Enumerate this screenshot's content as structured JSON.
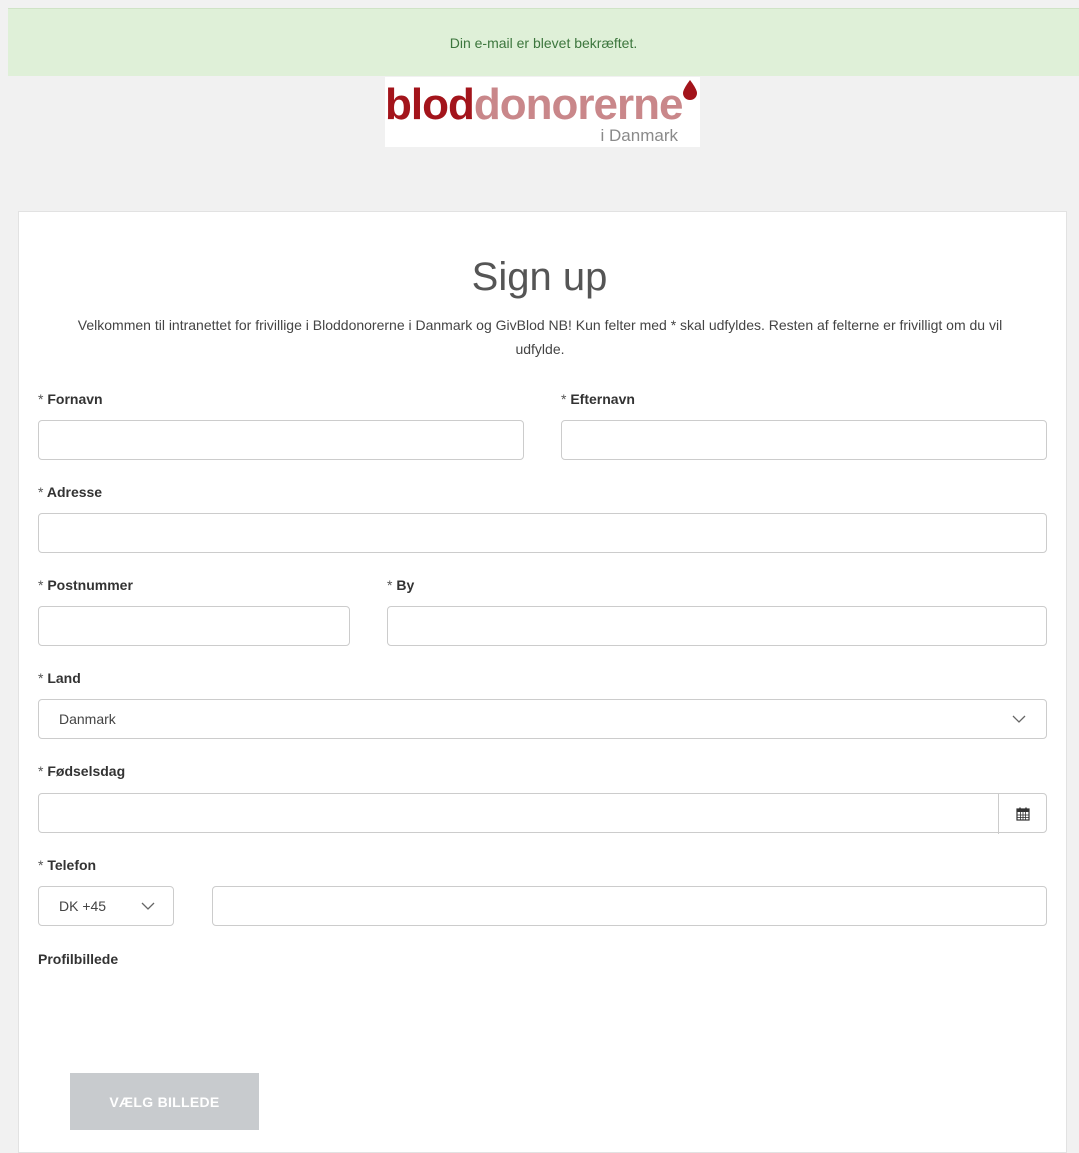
{
  "alert": {
    "message": "Din e-mail er blevet bekræftet."
  },
  "logo": {
    "part_dark": "blod",
    "part_light": "donorerne",
    "sub": "i Danmark"
  },
  "form": {
    "title": "Sign up",
    "intro": "Velkommen til intranettet for frivillige i Bloddonorerne i Danmark og GivBlod NB! Kun felter med * skal udfyldes. Resten af felterne er frivilligt om du vil udfylde.",
    "required_marker": "*",
    "fields": {
      "fornavn": {
        "label": "Fornavn",
        "value": ""
      },
      "efternavn": {
        "label": "Efternavn",
        "value": ""
      },
      "adresse": {
        "label": "Adresse",
        "value": ""
      },
      "postnummer": {
        "label": "Postnummer",
        "value": ""
      },
      "by": {
        "label": "By",
        "value": ""
      },
      "land": {
        "label": "Land",
        "value": "Danmark"
      },
      "foedselsdag": {
        "label": "Fødselsdag",
        "value": ""
      },
      "telefon": {
        "label": "Telefon",
        "country_code": "DK +45",
        "value": ""
      },
      "profilbillede": {
        "label": "Profilbillede"
      }
    },
    "choose_image_button": "VÆLG BILLEDE"
  },
  "colors": {
    "alert_bg": "#dff0d8",
    "alert_text": "#3c763d",
    "brand_red": "#a3141b",
    "button_disabled": "#c8cbce"
  },
  "icons": [
    "chevron-down-icon",
    "calendar-icon",
    "blood-drop-icon"
  ]
}
